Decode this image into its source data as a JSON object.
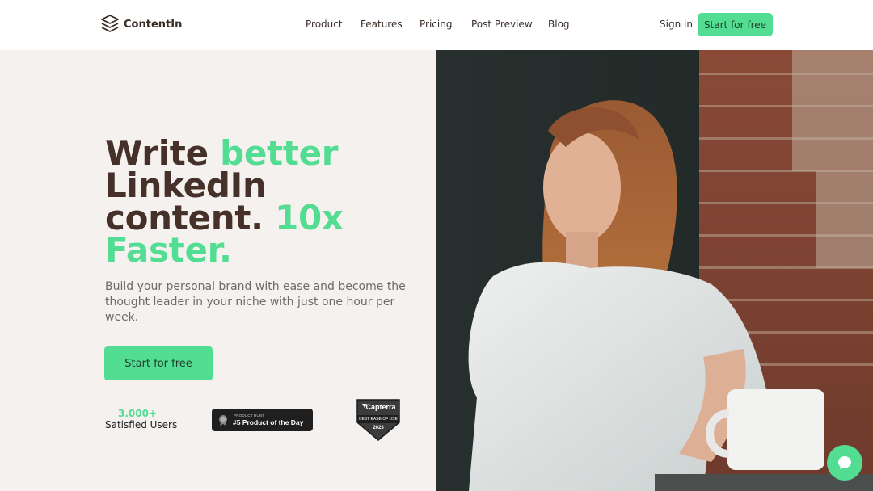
{
  "brand": {
    "name": "ContentIn",
    "accent": "#52dd93",
    "text_color": "#45302a"
  },
  "nav": {
    "items": [
      {
        "label": "Product"
      },
      {
        "label": "Features"
      },
      {
        "label": "Pricing"
      },
      {
        "label": "Post Preview"
      },
      {
        "label": "Blog"
      }
    ],
    "sign_in": "Sign in",
    "cta": "Start for free"
  },
  "hero": {
    "headline": {
      "part1": "Write ",
      "part2": "better",
      "part3": "LinkedIn",
      "part4": "content. ",
      "part5": "10x",
      "part6": "Faster."
    },
    "subtext": "Build your personal brand with ease and become the thought leader in your niche with just one hour per week.",
    "cta": "Start for free",
    "stats": {
      "number": "3.000+",
      "label": "Satisfied Users"
    },
    "product_hunt": {
      "small": "PRODUCT HUNT",
      "big": "#5 Product of the Day",
      "icon": "medal-icon"
    },
    "capterra": {
      "name": "Capterra",
      "line": "BEST EASE OF USE",
      "year": "2023"
    }
  },
  "chat": {
    "icon": "chat-bubble-icon"
  }
}
